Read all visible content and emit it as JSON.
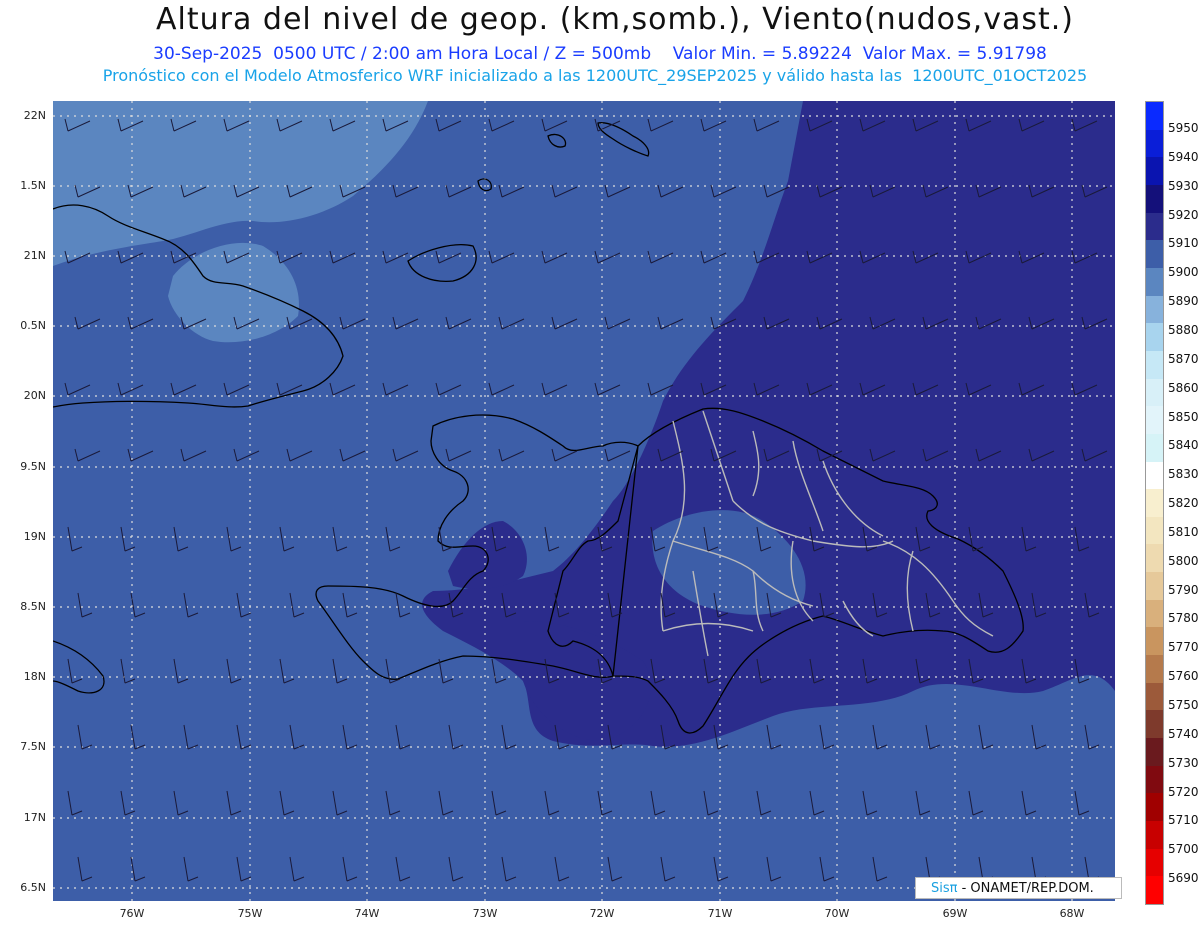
{
  "header": {
    "title": "Altura del nivel de geop. (km,somb.), Viento(nudos,vast.)",
    "subtitle": "30-Sep-2025  0500 UTC / 2:00 am Hora Local / Z = 500mb    Valor Min. = 5.89224  Valor Max. = 5.91798",
    "subtitle2": "Pronóstico con el Modelo Atmosferico WRF inicializado a las 1200UTC_29SEP2025 y válido hasta las  1200UTC_01OCT2025"
  },
  "map": {
    "lat_labels": [
      "22N",
      "1.5N",
      "21N",
      "0.5N",
      "20N",
      "9.5N",
      "19N",
      "8.5N",
      "18N",
      "7.5N",
      "17N",
      "6.5N"
    ],
    "lon_labels": [
      "76W",
      "75W",
      "74W",
      "73W",
      "72W",
      "71W",
      "70W",
      "69W",
      "68W"
    ],
    "colors": {
      "fill_5890": "#5b86c0",
      "fill_5900": "#3d5ea8",
      "fill_5910": "#2b2c8c",
      "coast": "#000000",
      "provinces": "#bbbbbb",
      "grid": "#dddddd"
    }
  },
  "colorbar": {
    "labels": [
      "5950",
      "5940",
      "5930",
      "5920",
      "5910",
      "5900",
      "5890",
      "5880",
      "5870",
      "5860",
      "5850",
      "5840",
      "5830",
      "5820",
      "5810",
      "5800",
      "5790",
      "5780",
      "5770",
      "5760",
      "5750",
      "5740",
      "5730",
      "5720",
      "5710",
      "5700",
      "5690"
    ],
    "colors": [
      "#0a2aff",
      "#0a1ed8",
      "#0a14b0",
      "#14107a",
      "#2b2c8c",
      "#3d5ea8",
      "#5b86c0",
      "#87b2dc",
      "#a8d4ee",
      "#c6e8f6",
      "#d8f0f8",
      "#e2f4fa",
      "#d6f3f7",
      "#ffffff",
      "#f8efcf",
      "#f3e6c0",
      "#eedab0",
      "#e6c99a",
      "#d9b07c",
      "#c9955f",
      "#b57a4c",
      "#9c5a3a",
      "#7e3a2c",
      "#6a1a1e",
      "#800a10",
      "#a00000",
      "#c80000",
      "#e60000",
      "#ff0000"
    ]
  },
  "credit": {
    "sis": "Sisπ",
    "org": " - ONAMET/REP.DOM."
  }
}
